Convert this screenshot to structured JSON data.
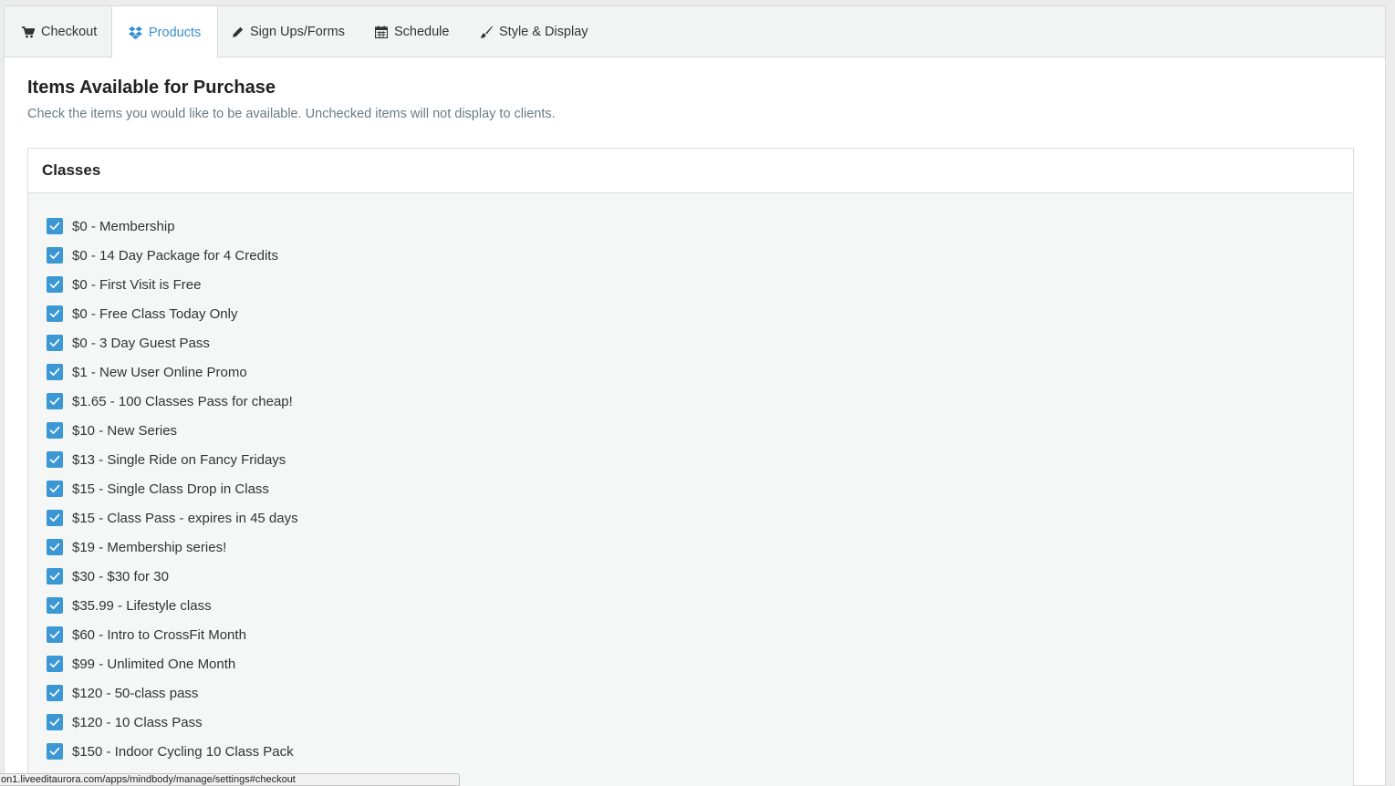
{
  "tabs": {
    "checkout": {
      "label": "Checkout",
      "icon": "cart-icon"
    },
    "products": {
      "label": "Products",
      "icon": "dropbox-icon"
    },
    "signups": {
      "label": "Sign Ups/Forms",
      "icon": "pencil-icon"
    },
    "schedule": {
      "label": "Schedule",
      "icon": "calendar-icon"
    },
    "style": {
      "label": "Style & Display",
      "icon": "paintbrush-icon"
    }
  },
  "colors": {
    "accent": "#3a8fd0",
    "checkbox": "#3b98d4"
  },
  "main": {
    "title": "Items Available for Purchase",
    "subtitle": "Check the items you would like to be available. Unchecked items will not display to clients."
  },
  "panel": {
    "title": "Classes",
    "items": [
      {
        "label": "$0 - Membership",
        "checked": true
      },
      {
        "label": "$0 - 14 Day Package for 4 Credits",
        "checked": true
      },
      {
        "label": "$0 - First Visit is Free",
        "checked": true
      },
      {
        "label": "$0 - Free Class Today Only",
        "checked": true
      },
      {
        "label": "$0 - 3 Day Guest Pass",
        "checked": true
      },
      {
        "label": "$1 - New User Online Promo",
        "checked": true
      },
      {
        "label": "$1.65 - 100 Classes Pass for cheap!",
        "checked": true
      },
      {
        "label": "$10 - New Series",
        "checked": true
      },
      {
        "label": "$13 - Single Ride on Fancy Fridays",
        "checked": true
      },
      {
        "label": "$15 - Single Class Drop in Class",
        "checked": true
      },
      {
        "label": "$15 - Class Pass - expires in 45 days",
        "checked": true
      },
      {
        "label": "$19 - Membership series!",
        "checked": true
      },
      {
        "label": "$30 - $30 for 30",
        "checked": true
      },
      {
        "label": "$35.99 - Lifestyle class",
        "checked": true
      },
      {
        "label": "$60 - Intro to CrossFit Month",
        "checked": true
      },
      {
        "label": "$99 - Unlimited One Month",
        "checked": true
      },
      {
        "label": "$120 - 50-class pass",
        "checked": true
      },
      {
        "label": "$120 - 10 Class Pass",
        "checked": true
      },
      {
        "label": "$150 - Indoor Cycling 10 Class Pack",
        "checked": true
      }
    ]
  },
  "statusbar": {
    "url": "on1.liveeditaurora.com/apps/mindbody/manage/settings#checkout"
  }
}
